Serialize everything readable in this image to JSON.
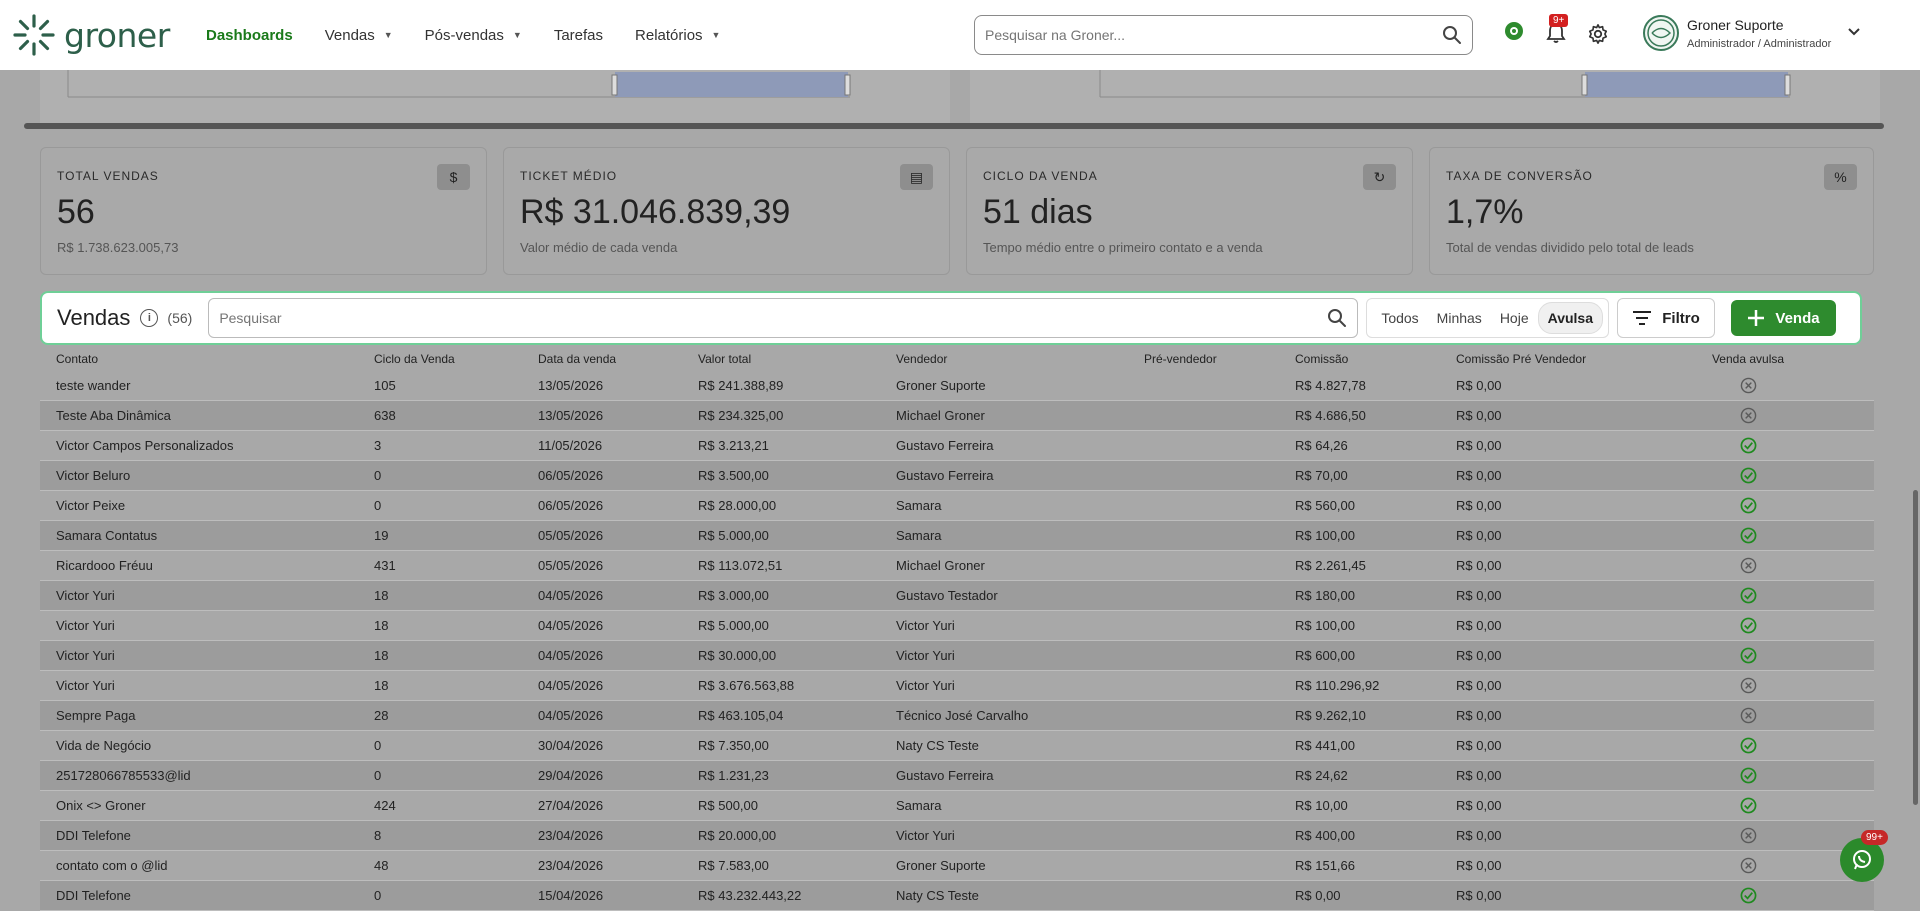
{
  "header": {
    "logo_text": "groner",
    "nav": [
      {
        "label": "Dashboards",
        "active": true,
        "dropdown": false
      },
      {
        "label": "Vendas",
        "active": false,
        "dropdown": true
      },
      {
        "label": "Pós-vendas",
        "active": false,
        "dropdown": true
      },
      {
        "label": "Tarefas",
        "active": false,
        "dropdown": false
      },
      {
        "label": "Relatórios",
        "active": false,
        "dropdown": true
      }
    ],
    "search_placeholder": "Pesquisar na Groner...",
    "notification_badge": "9+",
    "user_name": "Groner Suporte",
    "user_role": "Administrador / Administrador"
  },
  "kpis": [
    {
      "title": "TOTAL VENDAS",
      "value": "56",
      "sub": "R$ 1.738.623.005,73",
      "icon": "dollar-icon"
    },
    {
      "title": "TICKET MÉDIO",
      "value": "R$ 31.046.839,39",
      "sub": "Valor médio de cada venda",
      "icon": "ticket-icon"
    },
    {
      "title": "CICLO DA VENDA",
      "value": "51 dias",
      "sub": "Tempo médio entre o primeiro contato e a venda",
      "icon": "cycle-icon"
    },
    {
      "title": "TAXA DE CONVERSÃO",
      "value": "1,7%",
      "sub": "Total de vendas dividido pelo total de leads",
      "icon": "percent-icon"
    }
  ],
  "sales": {
    "title": "Vendas",
    "count": "(56)",
    "search_placeholder": "Pesquisar",
    "filters": [
      "Todos",
      "Minhas",
      "Hoje",
      "Avulsa"
    ],
    "active_filter": "Avulsa",
    "filter_label": "Filtro",
    "new_label": "Venda"
  },
  "table": {
    "columns": [
      "Contato",
      "Ciclo da Venda",
      "Data da venda",
      "Valor total",
      "Vendedor",
      "Pré-vendedor",
      "Comissão",
      "Comissão Pré Vendedor",
      "Venda avulsa"
    ],
    "rows": [
      {
        "contato": "teste wander",
        "ciclo": "105",
        "data": "13/05/2026",
        "valor": "R$ 241.388,89",
        "vendedor": "Groner Suporte",
        "pre": "",
        "comissao": "R$ 4.827,78",
        "com_pre": "R$ 0,00",
        "avulsa": false
      },
      {
        "contato": "Teste Aba Dinâmica",
        "ciclo": "638",
        "data": "13/05/2026",
        "valor": "R$ 234.325,00",
        "vendedor": "Michael Groner",
        "pre": "",
        "comissao": "R$ 4.686,50",
        "com_pre": "R$ 0,00",
        "avulsa": false
      },
      {
        "contato": "Victor Campos Personalizados",
        "ciclo": "3",
        "data": "11/05/2026",
        "valor": "R$ 3.213,21",
        "vendedor": "Gustavo Ferreira",
        "pre": "",
        "comissao": "R$ 64,26",
        "com_pre": "R$ 0,00",
        "avulsa": true
      },
      {
        "contato": "Victor Beluro",
        "ciclo": "0",
        "data": "06/05/2026",
        "valor": "R$ 3.500,00",
        "vendedor": "Gustavo Ferreira",
        "pre": "",
        "comissao": "R$ 70,00",
        "com_pre": "R$ 0,00",
        "avulsa": true
      },
      {
        "contato": "Victor Peixe",
        "ciclo": "0",
        "data": "06/05/2026",
        "valor": "R$ 28.000,00",
        "vendedor": "Samara",
        "pre": "",
        "comissao": "R$ 560,00",
        "com_pre": "R$ 0,00",
        "avulsa": true
      },
      {
        "contato": "Samara Contatus",
        "ciclo": "19",
        "data": "05/05/2026",
        "valor": "R$ 5.000,00",
        "vendedor": "Samara",
        "pre": "",
        "comissao": "R$ 100,00",
        "com_pre": "R$ 0,00",
        "avulsa": true
      },
      {
        "contato": "Ricardooo Fréuu",
        "ciclo": "431",
        "data": "05/05/2026",
        "valor": "R$ 113.072,51",
        "vendedor": "Michael Groner",
        "pre": "",
        "comissao": "R$ 2.261,45",
        "com_pre": "R$ 0,00",
        "avulsa": false
      },
      {
        "contato": "Victor Yuri",
        "ciclo": "18",
        "data": "04/05/2026",
        "valor": "R$ 3.000,00",
        "vendedor": "Gustavo Testador",
        "pre": "",
        "comissao": "R$ 180,00",
        "com_pre": "R$ 0,00",
        "avulsa": true
      },
      {
        "contato": "Victor Yuri",
        "ciclo": "18",
        "data": "04/05/2026",
        "valor": "R$ 5.000,00",
        "vendedor": "Victor Yuri",
        "pre": "",
        "comissao": "R$ 100,00",
        "com_pre": "R$ 0,00",
        "avulsa": true
      },
      {
        "contato": "Victor Yuri",
        "ciclo": "18",
        "data": "04/05/2026",
        "valor": "R$ 30.000,00",
        "vendedor": "Victor Yuri",
        "pre": "",
        "comissao": "R$ 600,00",
        "com_pre": "R$ 0,00",
        "avulsa": true
      },
      {
        "contato": "Victor Yuri",
        "ciclo": "18",
        "data": "04/05/2026",
        "valor": "R$ 3.676.563,88",
        "vendedor": "Victor Yuri",
        "pre": "",
        "comissao": "R$ 110.296,92",
        "com_pre": "R$ 0,00",
        "avulsa": false
      },
      {
        "contato": "Sempre Paga",
        "ciclo": "28",
        "data": "04/05/2026",
        "valor": "R$ 463.105,04",
        "vendedor": "Técnico José Carvalho",
        "pre": "",
        "comissao": "R$ 9.262,10",
        "com_pre": "R$ 0,00",
        "avulsa": false
      },
      {
        "contato": "Vida de Negócio",
        "ciclo": "0",
        "data": "30/04/2026",
        "valor": "R$ 7.350,00",
        "vendedor": "Naty CS Teste",
        "pre": "",
        "comissao": "R$ 441,00",
        "com_pre": "R$ 0,00",
        "avulsa": true
      },
      {
        "contato": "251728066785533@lid",
        "ciclo": "0",
        "data": "29/04/2026",
        "valor": "R$ 1.231,23",
        "vendedor": "Gustavo Ferreira",
        "pre": "",
        "comissao": "R$ 24,62",
        "com_pre": "R$ 0,00",
        "avulsa": true
      },
      {
        "contato": "Onix <> Groner",
        "ciclo": "424",
        "data": "27/04/2026",
        "valor": "R$ 500,00",
        "vendedor": "Samara",
        "pre": "",
        "comissao": "R$ 10,00",
        "com_pre": "R$ 0,00",
        "avulsa": true
      },
      {
        "contato": "DDI Telefone",
        "ciclo": "8",
        "data": "23/04/2026",
        "valor": "R$ 20.000,00",
        "vendedor": "Victor Yuri",
        "pre": "",
        "comissao": "R$ 400,00",
        "com_pre": "R$ 0,00",
        "avulsa": false
      },
      {
        "contato": "contato com o @lid",
        "ciclo": "48",
        "data": "23/04/2026",
        "valor": "R$ 7.583,00",
        "vendedor": "Groner Suporte",
        "pre": "",
        "comissao": "R$ 151,66",
        "com_pre": "R$ 0,00",
        "avulsa": false
      },
      {
        "contato": "DDI Telefone",
        "ciclo": "0",
        "data": "15/04/2026",
        "valor": "R$ 43.232.443,22",
        "vendedor": "Naty CS Teste",
        "pre": "",
        "comissao": "R$ 0,00",
        "com_pre": "R$ 0,00",
        "avulsa": true
      }
    ]
  },
  "whatsapp_badge": "99+",
  "colors": {
    "accent": "#2e8b2e",
    "brand": "#2d5f4a",
    "highlight_border": "#6fcf97",
    "check": "#1f8a1f",
    "cross": "#5a5a5a"
  }
}
